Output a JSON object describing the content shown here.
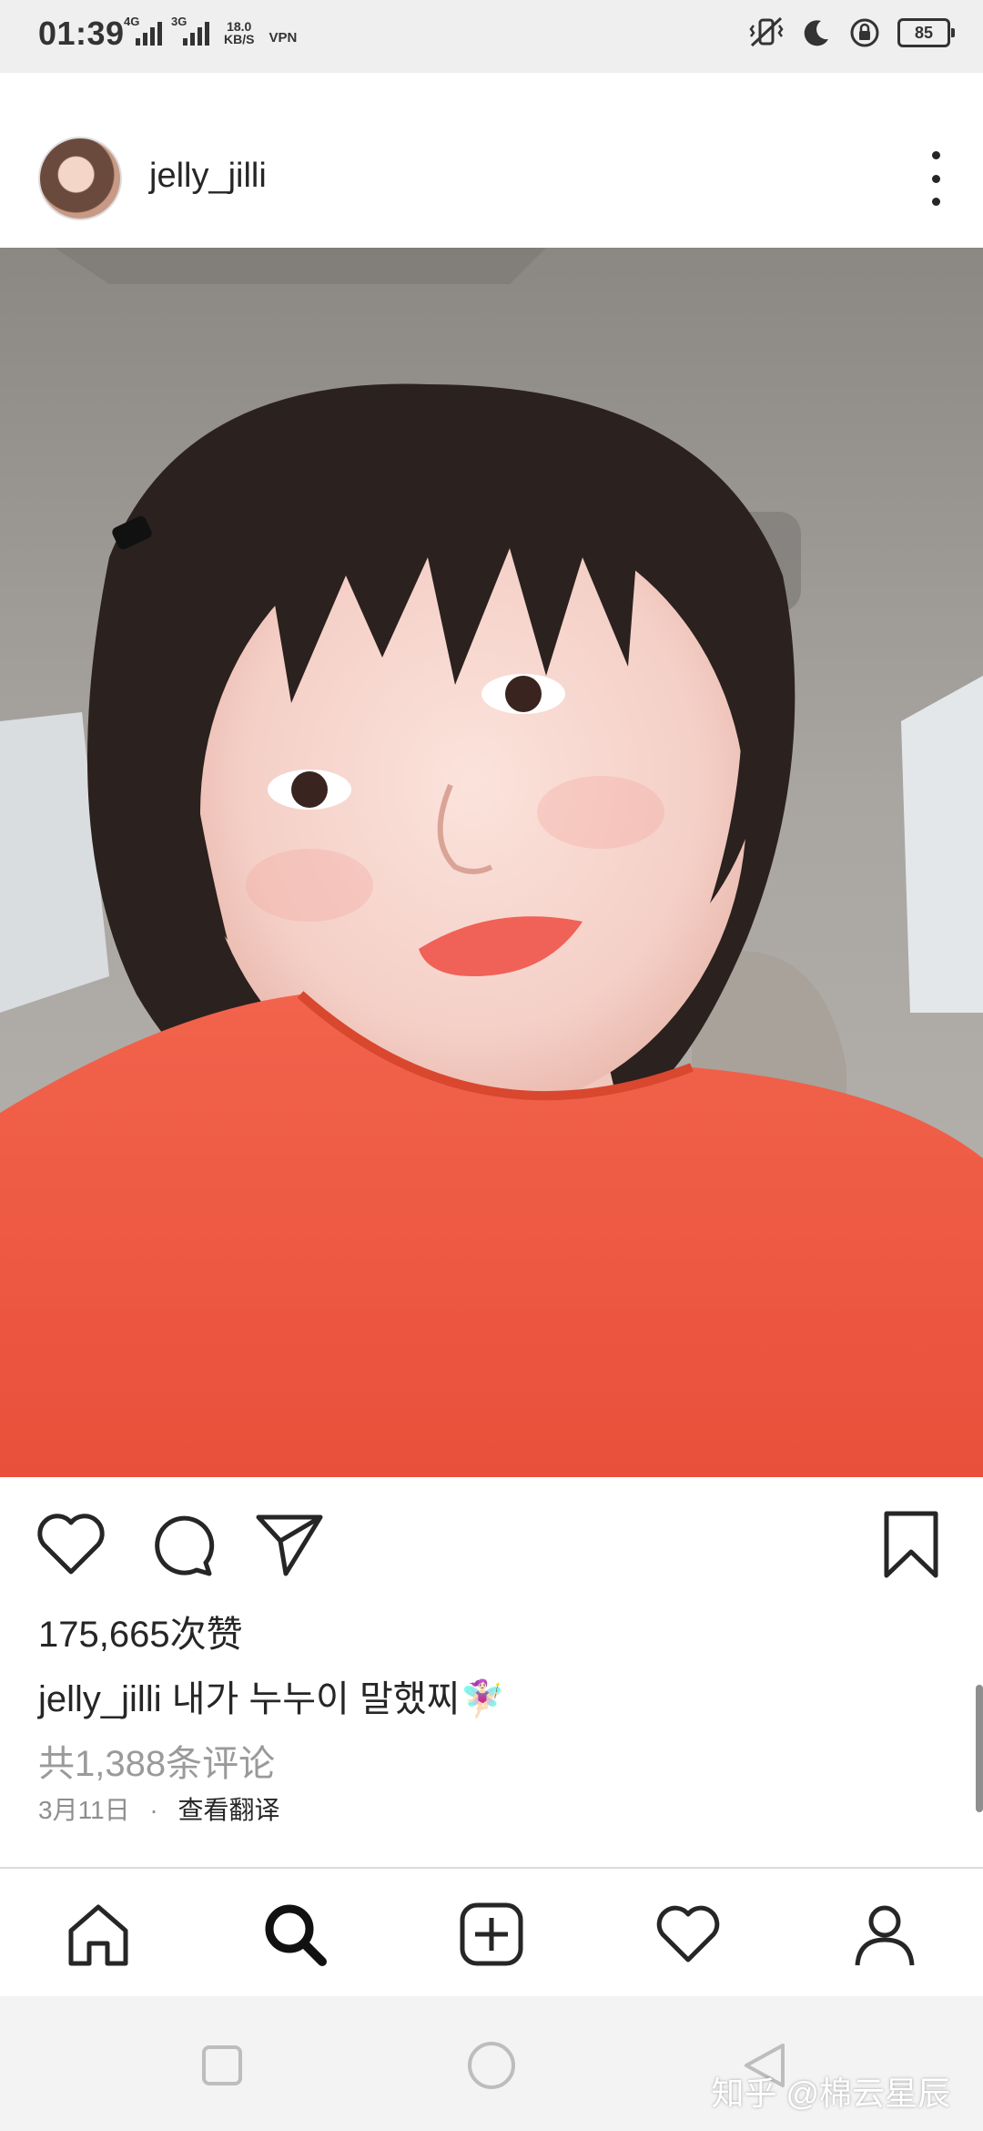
{
  "status_bar": {
    "time": "01:39",
    "signal_1": "4G",
    "signal_2": "3G",
    "speed_value": "18.0",
    "speed_unit": "KB/S",
    "vpn": "VPN",
    "battery": "85",
    "icons": [
      "vibrate-icon",
      "moon-icon",
      "lock-rotation-icon",
      "battery-icon"
    ]
  },
  "post": {
    "username": "jelly_jilli",
    "likes": "175,665次赞",
    "caption_username": "jelly_jilli",
    "caption_text": "내가 누누이 말했찌🧚🏻‍♀️",
    "comments": "共1,388条评论",
    "date": "3月11日",
    "separator": "·",
    "translate": "查看翻译"
  },
  "actions": {
    "icons": [
      "heart-icon",
      "comment-icon",
      "share-icon",
      "bookmark-icon"
    ]
  },
  "tabs": [
    "home-icon",
    "search-icon",
    "new-post-icon",
    "activity-icon",
    "profile-icon"
  ],
  "system_nav": [
    "recents-icon",
    "home-circle-icon",
    "back-icon"
  ],
  "watermark": "知乎 @棉云星辰",
  "colors": {
    "shirt": "#ef5a44",
    "background": "#ffffff",
    "text": "#262626",
    "muted": "#9a9a9a"
  }
}
